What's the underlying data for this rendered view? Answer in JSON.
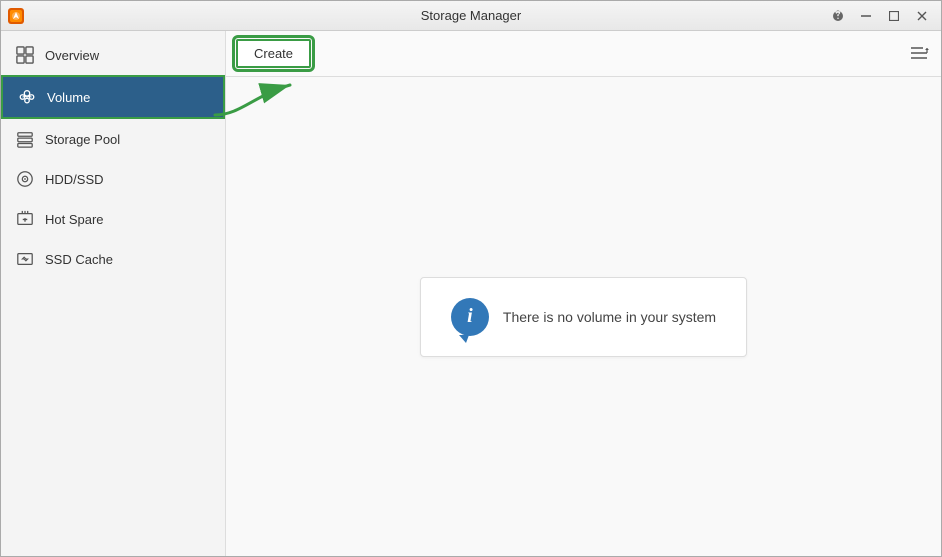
{
  "window": {
    "title": "Storage Manager",
    "controls": {
      "help": "?",
      "minimize": "—",
      "maximize": "□",
      "close": "✕"
    }
  },
  "sidebar": {
    "items": [
      {
        "id": "overview",
        "label": "Overview",
        "active": false
      },
      {
        "id": "volume",
        "label": "Volume",
        "active": true
      },
      {
        "id": "storage-pool",
        "label": "Storage Pool",
        "active": false
      },
      {
        "id": "hdd-ssd",
        "label": "HDD/SSD",
        "active": false
      },
      {
        "id": "hot-spare",
        "label": "Hot Spare",
        "active": false
      },
      {
        "id": "ssd-cache",
        "label": "SSD Cache",
        "active": false
      }
    ]
  },
  "toolbar": {
    "create_label": "Create"
  },
  "content": {
    "empty_message": "There is no volume in your system"
  }
}
